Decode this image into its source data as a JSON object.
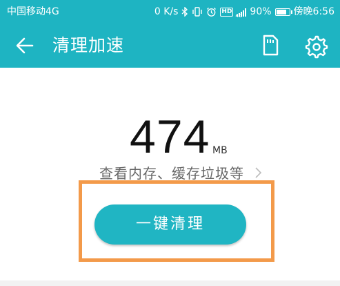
{
  "status_bar": {
    "carrier": "中国移动4G",
    "net_speed": "0 K/s",
    "hd_badge": "HD",
    "network_type": "4G",
    "battery": "90%",
    "time": "傍晚6:56",
    "battery_level": 0.9
  },
  "app_bar": {
    "title": "清理加速"
  },
  "main": {
    "size_value": "474",
    "size_unit": "MB",
    "detail_link": "查看内存、缓存垃圾等",
    "clean_button": "一键清理"
  },
  "colors": {
    "accent": "#1eb4c2",
    "highlight": "#f39a4a"
  },
  "icons": {
    "back": "back-arrow-icon",
    "sd_card": "sd-card-icon",
    "settings": "gear-icon",
    "chevron": "chevron-right-icon"
  }
}
